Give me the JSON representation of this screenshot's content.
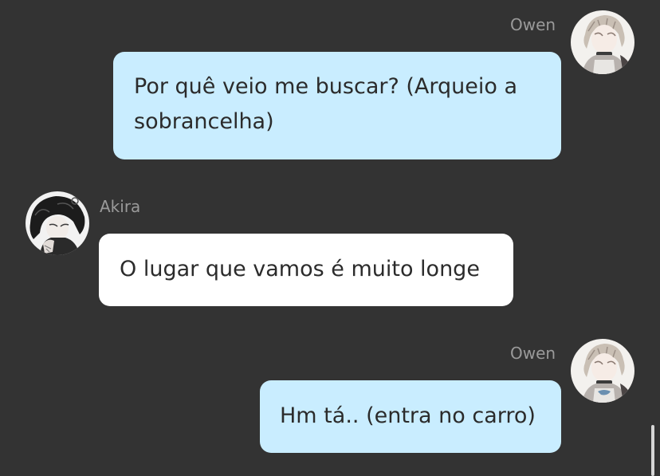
{
  "messages": [
    {
      "sender": "Owen",
      "direction": "outgoing",
      "text": "Por quê veio me buscar? (Arqueio a sobrancelha)",
      "avatar_icon": "owen-avatar"
    },
    {
      "sender": "Akira",
      "direction": "incoming",
      "text": "O lugar que vamos é muito longe",
      "avatar_icon": "akira-avatar"
    },
    {
      "sender": "Owen",
      "direction": "outgoing",
      "text": "Hm tá.. (entra no carro)",
      "avatar_icon": "owen-avatar"
    }
  ],
  "colors": {
    "background": "#333333",
    "outgoing_bubble": "#c9edff",
    "incoming_bubble": "#ffffff",
    "sender_name": "#9a9a9a",
    "message_text": "#2b2b2b"
  }
}
